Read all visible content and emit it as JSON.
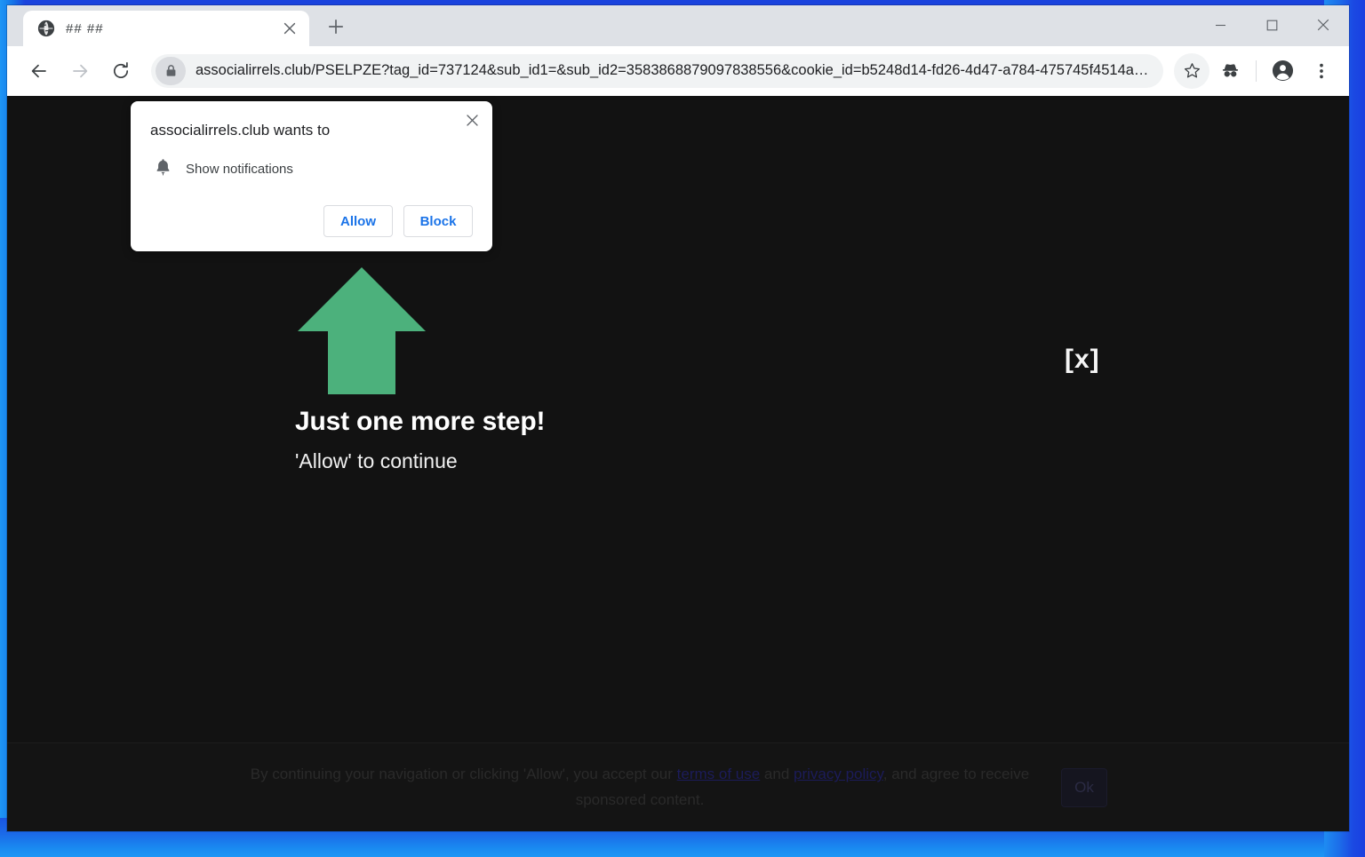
{
  "window": {
    "controls": {
      "minimize": "minimize-window",
      "maximize": "maximize-window",
      "close": "close-window"
    }
  },
  "tab_strip": {
    "tabs": [
      {
        "title": "## ##",
        "favicon": "globe-icon",
        "close_label": "close-tab"
      }
    ],
    "new_tab_label": "new-tab"
  },
  "toolbar": {
    "back_label": "back",
    "forward_label": "forward",
    "reload_label": "reload",
    "site_info_icon": "lock-icon",
    "url": "associalirrels.club/PSELPZE?tag_id=737124&sub_id1=&sub_id2=3583868879097838556&cookie_id=b5248d14-fd26-4d47-a784-475745f4514a…",
    "bookmark_icon": "star-icon",
    "extension_icon": "incognito-spy-icon",
    "profile_icon": "account-avatar-icon",
    "menu_icon": "three-dot-menu-icon"
  },
  "permission_bubble": {
    "title": "associalirrels.club wants to",
    "request_icon": "bell-icon",
    "request_label": "Show notifications",
    "allow_label": "Allow",
    "block_label": "Block",
    "close_label": "close-permission-bubble"
  },
  "page": {
    "background_color": "#121212",
    "arrow_color": "#4CB17C",
    "arrow_icon": "up-arrow-icon",
    "headline": "Just one more step!",
    "subline": "'Allow' to continue",
    "close_badge": "[x]"
  },
  "consent_banner": {
    "text_part1": "By continuing your navigation or clicking 'Allow', you accept our ",
    "link1": "terms of use",
    "text_part2": " and ",
    "link2": "privacy policy",
    "text_part3": ", and agree to receive sponsored content.",
    "ok_label": "Ok"
  },
  "colors": {
    "desktop_frame": "#1a6ee8",
    "chrome_blue": "#1a73e8",
    "page_background": "#121212",
    "arrow_green": "#4CB17C",
    "banner_background": "#141414"
  }
}
